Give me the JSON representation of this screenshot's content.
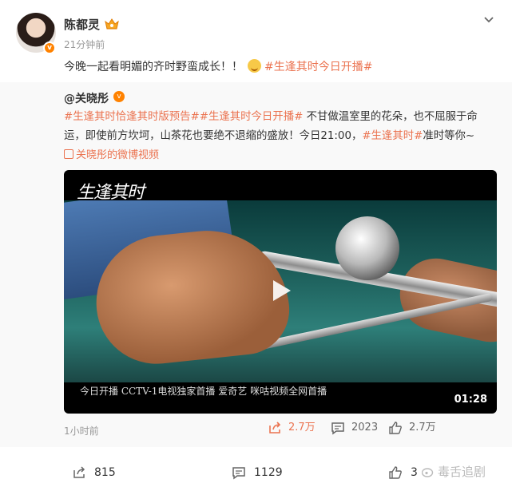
{
  "post": {
    "author": "陈都灵",
    "timestamp": "21分钟前",
    "text_before": "今晚一起看明媚的齐时野蛮成长！！",
    "hashtag": "#生逢其时今日开播#",
    "icons": {
      "avatar_badge": "v-badge-icon",
      "crown": "crown-icon",
      "menu": "chevron-down-icon",
      "emoji": "laughing-emoji-icon"
    }
  },
  "retweet": {
    "author": "@关晓彤",
    "line1_tags": "#生逢其时恰逢其时版预告##生逢其时今日开播#",
    "line1_text": " 不甘做温室里的花朵，也不屈服于命",
    "line2_text": "运，即使前方坎坷，山茶花也要绝不退缩的盛放！今日21:00，",
    "line2_tag": "#生逢其时#",
    "line2_end": "准时等你~",
    "video_link": "关晓彤的微博视频",
    "video": {
      "logo": "生逢其时",
      "subtitle": "今日开播 CCTV-1电视独家首播 爱奇艺 咪咕视频全网首播",
      "duration": "01:28"
    },
    "time": "1小时前",
    "shares": "2.7万",
    "comments": "2023",
    "likes": "2.7万"
  },
  "footer": {
    "shares": "815",
    "comments": "1129",
    "likes": "3",
    "watermark": "毒舌追剧"
  },
  "colors": {
    "accent": "#eb7350",
    "brand_orange": "#ff8200",
    "muted": "#999999"
  }
}
